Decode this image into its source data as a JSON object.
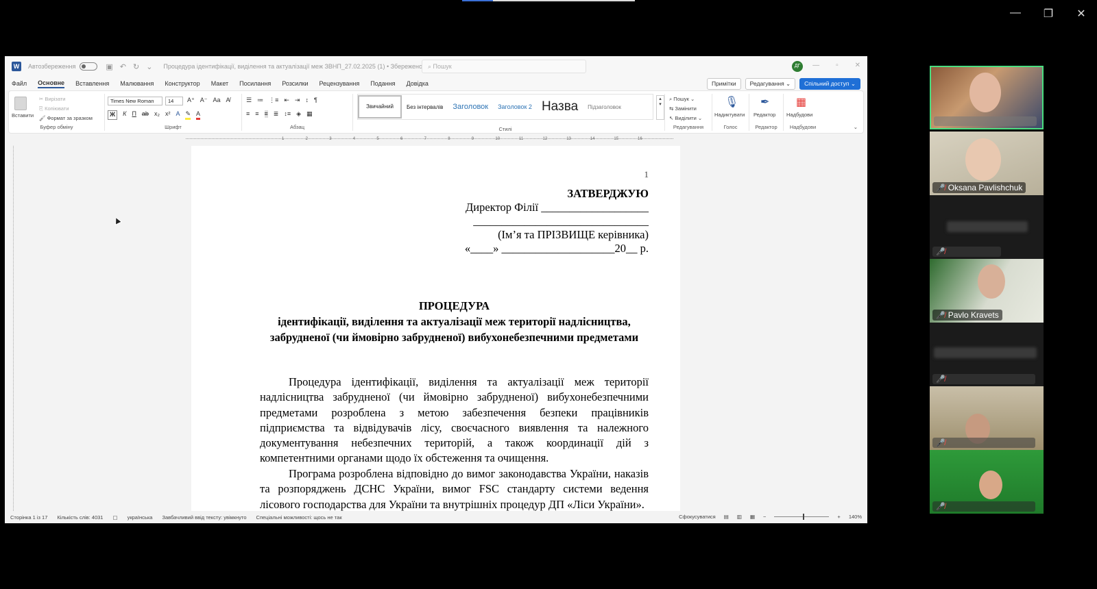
{
  "top_progress_percent": 18,
  "word": {
    "autosave_label": "Автозбереження",
    "doc_title": "Процедура ідентифікації, виділення та актуалізації меж ЗВНП_27.02.2025 (1) • Збережено ⌄",
    "search_placeholder": "Пошук",
    "user_initials": "ДГ",
    "menu_tabs": [
      "Файл",
      "Основне",
      "Вставлення",
      "Малювання",
      "Конструктор",
      "Макет",
      "Посилання",
      "Розсилки",
      "Рецензування",
      "Подання",
      "Довідка"
    ],
    "active_tab": "Основне",
    "notes_label": "Примітки",
    "edit_label": "Редагування ⌄",
    "share_label": "Спільний доступ ⌄",
    "ribbon": {
      "paste_label": "Вставити",
      "cut_label": "Вирізати",
      "copy_label": "Копіювати",
      "format_painter_label": "Формат за зразком",
      "clipboard_group": "Буфер обміну",
      "font_name": "Times New Roman",
      "font_size": "14",
      "font_group": "Шрифт",
      "paragraph_group": "Абзац",
      "styles": [
        "Звичайний",
        "Без інтервалів",
        "Заголовок",
        "Заголовок 2",
        "Назва",
        "Підзаголовок"
      ],
      "styles_group": "Стилі",
      "find_label": "Пошук ⌄",
      "replace_label": "Замінити",
      "select_label": "Виділити ⌄",
      "editing_group": "Редагування",
      "dictate_label": "Надиктувати",
      "voice_group": "Голос",
      "editor_label": "Редактор",
      "editor_group": "Редактор",
      "addins_label": "Надбудови",
      "addins_group": "Надбудови"
    },
    "ruler_numbers": [
      "1",
      "2",
      "3",
      "4",
      "5",
      "6",
      "7",
      "8",
      "9",
      "10",
      "11",
      "12",
      "13",
      "14",
      "15",
      "16"
    ],
    "document": {
      "page_number": "1",
      "approve": "ЗАТВЕРДЖУЮ",
      "director_line": "Директор Філії ___________________",
      "name_blank": "_______________________________",
      "name_hint": "(Ім’я та ПРІЗВИЩЕ керівника)",
      "date_line": "«____» ____________________20__ р.",
      "heading_1": "ПРОЦЕДУРА",
      "heading_2": "ідентифікації, виділення та актуалізації меж території надлісництва,",
      "heading_3": "забрудненої (чи ймовірно забрудненої) вибухонебезпечними предметами",
      "para_1": "Процедура ідентифікації, виділення та актуалізації меж території надлісництва забрудненої (чи ймовірно забрудненої) вибухонебезпечними предметами розроблена з метою забезпечення безпеки працівників підприємства та відвідувачів лісу, своєчасного виявлення та належного документування небезпечних територій, а також координації дій з компетентними органами щодо їх обстеження та очищення.",
      "para_2": "Програма розроблена відповідно до вимог законодавства України, наказів та розпоряджень ДСНС України, вимог FSC стандарту системи ведення лісового господарства для України та внутрішніх процедур ДП «Ліси України»."
    },
    "status": {
      "page": "Сторінка 1 із 17",
      "words": "Кількість слів: 4031",
      "language": "українська",
      "predictive": "Завбачливий ввід тексту: увімкнуто",
      "accessibility": "Спеціальні можливості: щось не так",
      "focus": "Сфокусуватися",
      "zoom": "140%"
    }
  },
  "participants": [
    {
      "name": "",
      "muted": false,
      "active": true
    },
    {
      "name": "Oksana Pavlishchuk",
      "muted": true
    },
    {
      "name": "",
      "muted": true
    },
    {
      "name": "Pavlo Kravets",
      "muted": true
    },
    {
      "name": "",
      "muted": true
    },
    {
      "name": "",
      "muted": true
    },
    {
      "name": "",
      "muted": true
    }
  ],
  "colors": {
    "word_blue": "#2b579a",
    "share_blue": "#1f6fd6",
    "active_speaker": "#4ade80",
    "mute_red": "#ff4d4d"
  }
}
